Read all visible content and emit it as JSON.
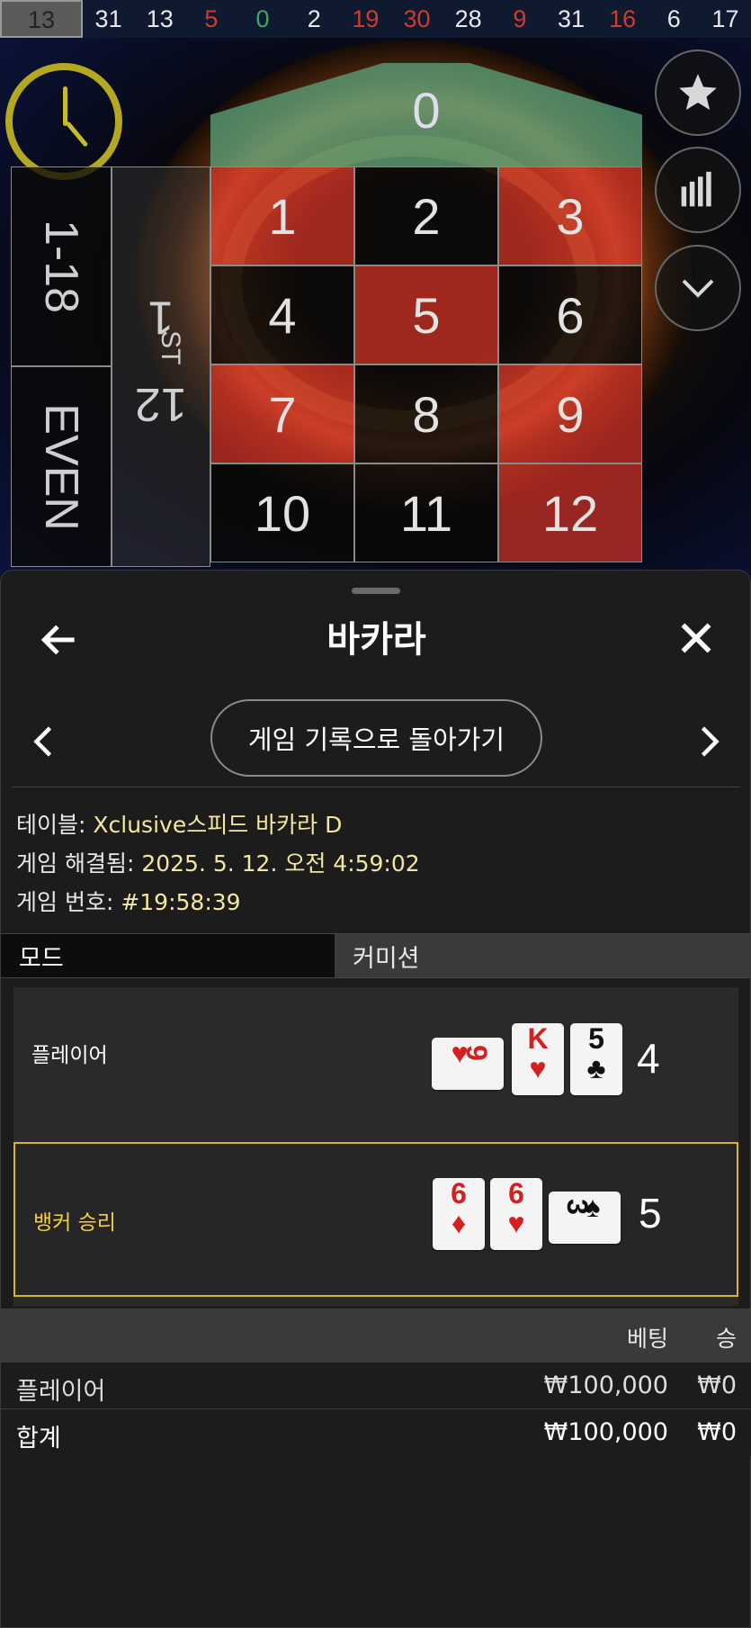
{
  "history_bar": {
    "numbers": [
      {
        "value": "13",
        "color": "#222222"
      },
      {
        "value": "31",
        "color": "#e8e8e8"
      },
      {
        "value": "13",
        "color": "#e8e8e8"
      },
      {
        "value": "5",
        "color": "#d23a2a"
      },
      {
        "value": "0",
        "color": "#3aa86a"
      },
      {
        "value": "2",
        "color": "#e8e8e8"
      },
      {
        "value": "19",
        "color": "#d23a2a"
      },
      {
        "value": "30",
        "color": "#d23a2a"
      },
      {
        "value": "28",
        "color": "#e8e8e8"
      },
      {
        "value": "9",
        "color": "#d23a2a"
      },
      {
        "value": "31",
        "color": "#e8e8e8"
      },
      {
        "value": "16",
        "color": "#d23a2a"
      },
      {
        "value": "6",
        "color": "#e8e8e8"
      },
      {
        "value": "17",
        "color": "#e8e8e8"
      }
    ]
  },
  "side_buttons": {
    "favorite_icon": "star-icon",
    "stats_icon": "bar-chart-icon",
    "collapse_icon": "chevron-down-icon"
  },
  "roulette": {
    "zero": "0",
    "dozen_label": "1",
    "dozen_sup": "ST",
    "dozen_num": "12",
    "side_low": "1-18",
    "side_even": "EVEN",
    "cells": [
      {
        "n": "1",
        "color": "red"
      },
      {
        "n": "2",
        "color": "black"
      },
      {
        "n": "3",
        "color": "red"
      },
      {
        "n": "4",
        "color": "black"
      },
      {
        "n": "5",
        "color": "red"
      },
      {
        "n": "6",
        "color": "black"
      },
      {
        "n": "7",
        "color": "red"
      },
      {
        "n": "8",
        "color": "black"
      },
      {
        "n": "9",
        "color": "red"
      },
      {
        "n": "10",
        "color": "black"
      },
      {
        "n": "11",
        "color": "black"
      },
      {
        "n": "12",
        "color": "red"
      }
    ]
  },
  "sheet": {
    "title": "바카라",
    "back_history_label": "게임 기록으로 돌아가기",
    "info": {
      "table_label": "테이블:",
      "table_value": "Xclusive스피드 바카라 D",
      "resolved_label": "게임 해결됨:",
      "resolved_value": "2025. 5. 12. 오전 4:59:02",
      "number_label": "게임 번호:",
      "number_value": "#19:58:39"
    },
    "tabs": {
      "mode": "모드",
      "commission": "커미션"
    },
    "player": {
      "label": "플레이어",
      "score": "4",
      "cards": [
        {
          "rank": "9",
          "suit": "♥"
        },
        {
          "rank": "K",
          "suit": "♥"
        },
        {
          "rank": "5",
          "suit": "♣"
        }
      ]
    },
    "banker": {
      "label": "뱅커 승리",
      "score": "5",
      "cards": [
        {
          "rank": "6",
          "suit": "♦"
        },
        {
          "rank": "6",
          "suit": "♥"
        },
        {
          "rank": "3",
          "suit": "♠"
        }
      ]
    },
    "table": {
      "col_bet": "베팅",
      "col_win": "승",
      "rows": [
        {
          "name": "플레이어",
          "bet": "₩100,000",
          "win": "₩0"
        }
      ],
      "total": {
        "name": "합계",
        "bet": "₩100,000",
        "win": "₩0"
      }
    }
  }
}
